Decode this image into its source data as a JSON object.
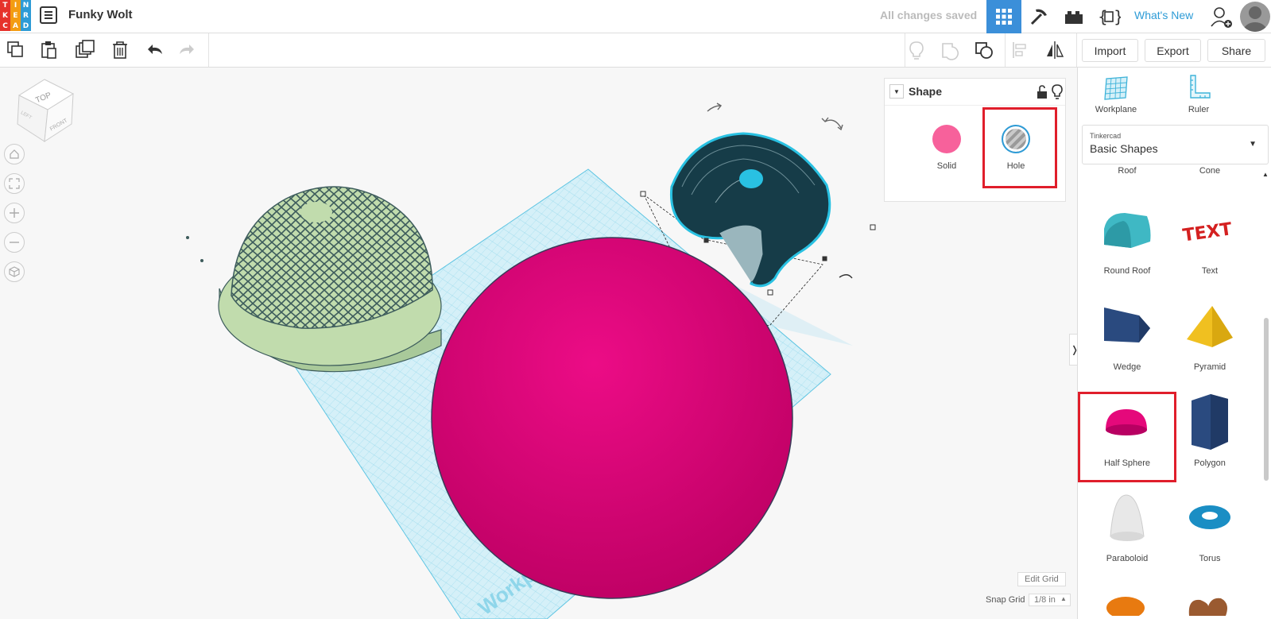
{
  "app": {
    "logo_letters": [
      "T",
      "I",
      "N",
      "K",
      "E",
      "R",
      "C",
      "A",
      "D"
    ],
    "logo_colors": [
      "#e6322a",
      "#f39c12",
      "#2d9bd6",
      "#e6322a",
      "#f39c12",
      "#2d9bd6",
      "#e6322a",
      "#f39c12",
      "#2d9bd6"
    ],
    "design_title": "Funky Wolt",
    "save_status": "All changes saved",
    "whats_new": "What's New",
    "accent": "#3b8fd9"
  },
  "toolbar": {
    "import_label": "Import",
    "export_label": "Export",
    "share_label": "Share"
  },
  "viewcube": {
    "top": "TOP",
    "front": "FRONT",
    "left": "LEFT"
  },
  "workplane_label": "Workplane",
  "shape_panel": {
    "title": "Shape",
    "solid_label": "Solid",
    "hole_label": "Hole",
    "solid_color": "#f06292"
  },
  "grid_controls": {
    "edit_grid": "Edit Grid",
    "snap_label": "Snap Grid",
    "snap_value": "1/8 in"
  },
  "sidebar": {
    "workplane_tool": "Workplane",
    "ruler_tool": "Ruler",
    "library_provider": "Tinkercad",
    "library_name": "Basic Shapes",
    "partial_labels": [
      "Roof",
      "Cone"
    ],
    "shapes": [
      {
        "label": "Round Roof",
        "icon": "round-roof-icon"
      },
      {
        "label": "Text",
        "icon": "text-shape-icon"
      },
      {
        "label": "Wedge",
        "icon": "wedge-icon"
      },
      {
        "label": "Pyramid",
        "icon": "pyramid-icon"
      },
      {
        "label": "Half Sphere",
        "icon": "half-sphere-icon"
      },
      {
        "label": "Polygon",
        "icon": "polygon-icon"
      },
      {
        "label": "Paraboloid",
        "icon": "paraboloid-icon"
      },
      {
        "label": "Torus",
        "icon": "torus-icon"
      }
    ]
  }
}
